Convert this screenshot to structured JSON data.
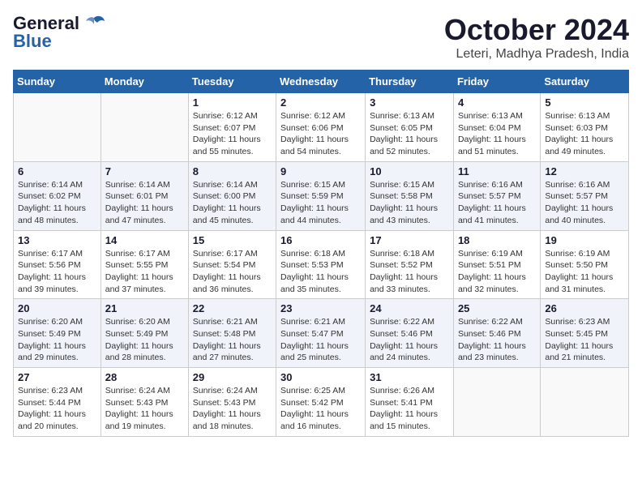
{
  "header": {
    "logo_line1": "General",
    "logo_line2": "Blue",
    "month": "October 2024",
    "location": "Leteri, Madhya Pradesh, India"
  },
  "weekdays": [
    "Sunday",
    "Monday",
    "Tuesday",
    "Wednesday",
    "Thursday",
    "Friday",
    "Saturday"
  ],
  "weeks": [
    [
      {
        "day": "",
        "info": ""
      },
      {
        "day": "",
        "info": ""
      },
      {
        "day": "1",
        "info": "Sunrise: 6:12 AM\nSunset: 6:07 PM\nDaylight: 11 hours and 55 minutes."
      },
      {
        "day": "2",
        "info": "Sunrise: 6:12 AM\nSunset: 6:06 PM\nDaylight: 11 hours and 54 minutes."
      },
      {
        "day": "3",
        "info": "Sunrise: 6:13 AM\nSunset: 6:05 PM\nDaylight: 11 hours and 52 minutes."
      },
      {
        "day": "4",
        "info": "Sunrise: 6:13 AM\nSunset: 6:04 PM\nDaylight: 11 hours and 51 minutes."
      },
      {
        "day": "5",
        "info": "Sunrise: 6:13 AM\nSunset: 6:03 PM\nDaylight: 11 hours and 49 minutes."
      }
    ],
    [
      {
        "day": "6",
        "info": "Sunrise: 6:14 AM\nSunset: 6:02 PM\nDaylight: 11 hours and 48 minutes."
      },
      {
        "day": "7",
        "info": "Sunrise: 6:14 AM\nSunset: 6:01 PM\nDaylight: 11 hours and 47 minutes."
      },
      {
        "day": "8",
        "info": "Sunrise: 6:14 AM\nSunset: 6:00 PM\nDaylight: 11 hours and 45 minutes."
      },
      {
        "day": "9",
        "info": "Sunrise: 6:15 AM\nSunset: 5:59 PM\nDaylight: 11 hours and 44 minutes."
      },
      {
        "day": "10",
        "info": "Sunrise: 6:15 AM\nSunset: 5:58 PM\nDaylight: 11 hours and 43 minutes."
      },
      {
        "day": "11",
        "info": "Sunrise: 6:16 AM\nSunset: 5:57 PM\nDaylight: 11 hours and 41 minutes."
      },
      {
        "day": "12",
        "info": "Sunrise: 6:16 AM\nSunset: 5:57 PM\nDaylight: 11 hours and 40 minutes."
      }
    ],
    [
      {
        "day": "13",
        "info": "Sunrise: 6:17 AM\nSunset: 5:56 PM\nDaylight: 11 hours and 39 minutes."
      },
      {
        "day": "14",
        "info": "Sunrise: 6:17 AM\nSunset: 5:55 PM\nDaylight: 11 hours and 37 minutes."
      },
      {
        "day": "15",
        "info": "Sunrise: 6:17 AM\nSunset: 5:54 PM\nDaylight: 11 hours and 36 minutes."
      },
      {
        "day": "16",
        "info": "Sunrise: 6:18 AM\nSunset: 5:53 PM\nDaylight: 11 hours and 35 minutes."
      },
      {
        "day": "17",
        "info": "Sunrise: 6:18 AM\nSunset: 5:52 PM\nDaylight: 11 hours and 33 minutes."
      },
      {
        "day": "18",
        "info": "Sunrise: 6:19 AM\nSunset: 5:51 PM\nDaylight: 11 hours and 32 minutes."
      },
      {
        "day": "19",
        "info": "Sunrise: 6:19 AM\nSunset: 5:50 PM\nDaylight: 11 hours and 31 minutes."
      }
    ],
    [
      {
        "day": "20",
        "info": "Sunrise: 6:20 AM\nSunset: 5:49 PM\nDaylight: 11 hours and 29 minutes."
      },
      {
        "day": "21",
        "info": "Sunrise: 6:20 AM\nSunset: 5:49 PM\nDaylight: 11 hours and 28 minutes."
      },
      {
        "day": "22",
        "info": "Sunrise: 6:21 AM\nSunset: 5:48 PM\nDaylight: 11 hours and 27 minutes."
      },
      {
        "day": "23",
        "info": "Sunrise: 6:21 AM\nSunset: 5:47 PM\nDaylight: 11 hours and 25 minutes."
      },
      {
        "day": "24",
        "info": "Sunrise: 6:22 AM\nSunset: 5:46 PM\nDaylight: 11 hours and 24 minutes."
      },
      {
        "day": "25",
        "info": "Sunrise: 6:22 AM\nSunset: 5:46 PM\nDaylight: 11 hours and 23 minutes."
      },
      {
        "day": "26",
        "info": "Sunrise: 6:23 AM\nSunset: 5:45 PM\nDaylight: 11 hours and 21 minutes."
      }
    ],
    [
      {
        "day": "27",
        "info": "Sunrise: 6:23 AM\nSunset: 5:44 PM\nDaylight: 11 hours and 20 minutes."
      },
      {
        "day": "28",
        "info": "Sunrise: 6:24 AM\nSunset: 5:43 PM\nDaylight: 11 hours and 19 minutes."
      },
      {
        "day": "29",
        "info": "Sunrise: 6:24 AM\nSunset: 5:43 PM\nDaylight: 11 hours and 18 minutes."
      },
      {
        "day": "30",
        "info": "Sunrise: 6:25 AM\nSunset: 5:42 PM\nDaylight: 11 hours and 16 minutes."
      },
      {
        "day": "31",
        "info": "Sunrise: 6:26 AM\nSunset: 5:41 PM\nDaylight: 11 hours and 15 minutes."
      },
      {
        "day": "",
        "info": ""
      },
      {
        "day": "",
        "info": ""
      }
    ]
  ]
}
